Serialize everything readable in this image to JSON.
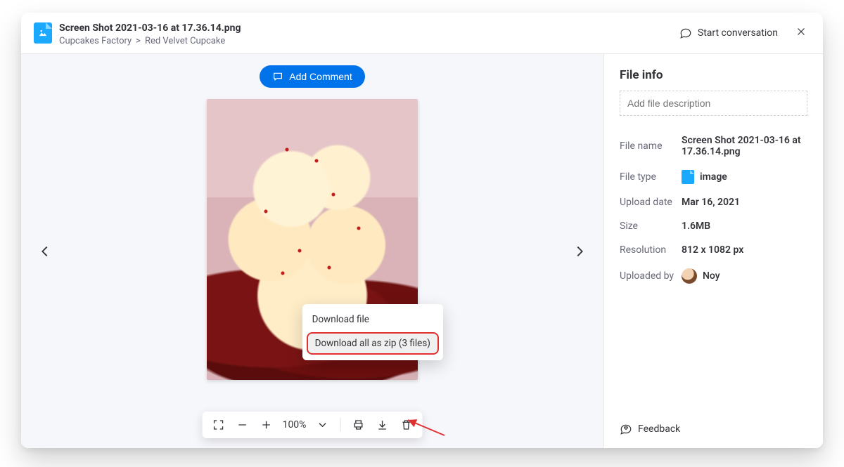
{
  "header": {
    "file_title": "Screen Shot 2021-03-16 at 17.36.14.png",
    "breadcrumb_root": "Cupcakes Factory",
    "breadcrumb_sep": ">",
    "breadcrumb_item": "Red Velvet Cupcake",
    "start_conversation": "Start conversation"
  },
  "viewer": {
    "add_comment": "Add Comment",
    "zoom": "100%",
    "download_menu": {
      "download_file": "Download file",
      "download_zip": "Download all as zip (3 files)"
    }
  },
  "sidebar": {
    "title": "File info",
    "description_placeholder": "Add file description",
    "labels": {
      "file_name": "File name",
      "file_type": "File type",
      "upload_date": "Upload date",
      "size": "Size",
      "resolution": "Resolution",
      "uploaded_by": "Uploaded by"
    },
    "values": {
      "file_name": "Screen Shot 2021-03-16 at 17.36.14.png",
      "file_type": "image",
      "upload_date": "Mar 16, 2021",
      "size": "1.6MB",
      "resolution": "812 x 1082 px",
      "uploaded_by": "Noy"
    },
    "feedback": "Feedback"
  }
}
